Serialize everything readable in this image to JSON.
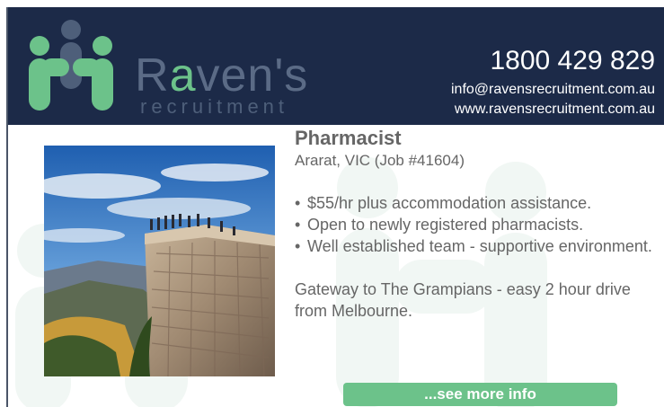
{
  "brand": {
    "name_part1": "R",
    "name_accent": "a",
    "name_part2": "ven's",
    "tagline": "recruitment",
    "logo_icon": "people-logo-icon",
    "colors": {
      "navy": "#1c2a48",
      "green": "#6cc28a",
      "slate": "#5b6b86"
    }
  },
  "contact": {
    "phone": "1800 429 829",
    "email": "info@ravensrecruitment.com.au",
    "website": "www.ravensrecruitment.com.au"
  },
  "job": {
    "title": "Pharmacist",
    "location": "Ararat, VIC (Job #41604)",
    "bullets": [
      "$55/hr plus accommodation assistance.",
      "Open to newly registered pharmacists.",
      "Well established team - supportive environment."
    ],
    "bullet_marker": "•",
    "description": "Gateway to The Grampians - easy 2 hour drive from Melbourne."
  },
  "cta": {
    "label": "...see more info"
  }
}
